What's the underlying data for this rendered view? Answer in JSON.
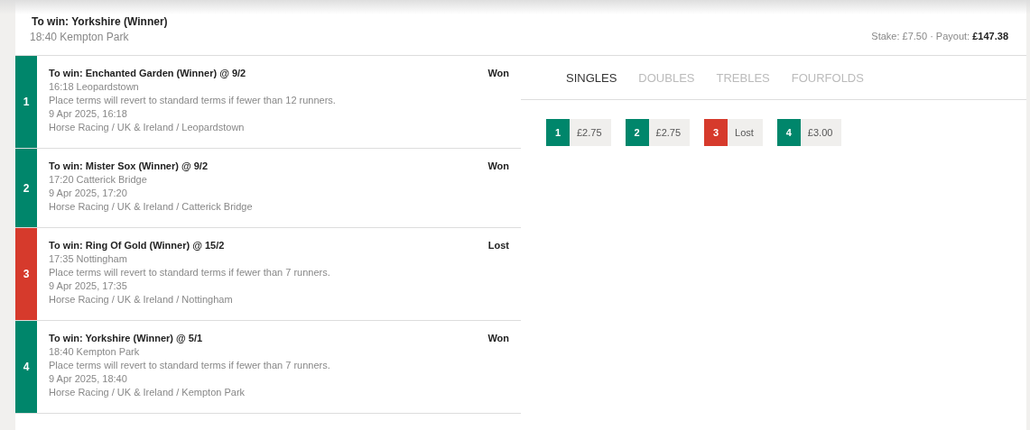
{
  "header": {
    "title": "To win: Yorkshire (Winner)",
    "subtitle": "18:40 Kempton Park",
    "stake_label": "Stake: £7.50 · Payout:",
    "payout": "£147.38"
  },
  "selections": [
    {
      "number": "1",
      "won": true,
      "title": "To win: Enchanted Garden (Winner) @ 9/2",
      "result": "Won",
      "lines": [
        "16:18 Leopardstown",
        "Place terms will revert to standard terms if fewer than 12 runners.",
        "9 Apr 2025, 16:18",
        "Horse Racing / UK & Ireland / Leopardstown"
      ]
    },
    {
      "number": "2",
      "won": true,
      "title": "To win: Mister Sox (Winner) @ 9/2",
      "result": "Won",
      "lines": [
        "17:20 Catterick Bridge",
        "9 Apr 2025, 17:20",
        "Horse Racing / UK & Ireland / Catterick Bridge"
      ]
    },
    {
      "number": "3",
      "won": false,
      "title": "To win: Ring Of Gold (Winner) @ 15/2",
      "result": "Lost",
      "lines": [
        "17:35 Nottingham",
        "Place terms will revert to standard terms if fewer than 7 runners.",
        "9 Apr 2025, 17:35",
        "Horse Racing / UK & Ireland / Nottingham"
      ]
    },
    {
      "number": "4",
      "won": true,
      "title": "To win: Yorkshire (Winner) @ 5/1",
      "result": "Won",
      "lines": [
        "18:40 Kempton Park",
        "Place terms will revert to standard terms if fewer than 7 runners.",
        "9 Apr 2025, 18:40",
        "Horse Racing / UK & Ireland / Kempton Park"
      ]
    }
  ],
  "tabs": [
    {
      "label": "SINGLES",
      "selected": true
    },
    {
      "label": "DOUBLES",
      "selected": false
    },
    {
      "label": "TREBLES",
      "selected": false
    },
    {
      "label": "FOURFOLDS",
      "selected": false
    }
  ],
  "singles": [
    {
      "number": "1",
      "won": true,
      "value": "£2.75"
    },
    {
      "number": "2",
      "won": true,
      "value": "£2.75"
    },
    {
      "number": "3",
      "won": false,
      "value": "Lost"
    },
    {
      "number": "4",
      "won": true,
      "value": "£3.00"
    }
  ]
}
